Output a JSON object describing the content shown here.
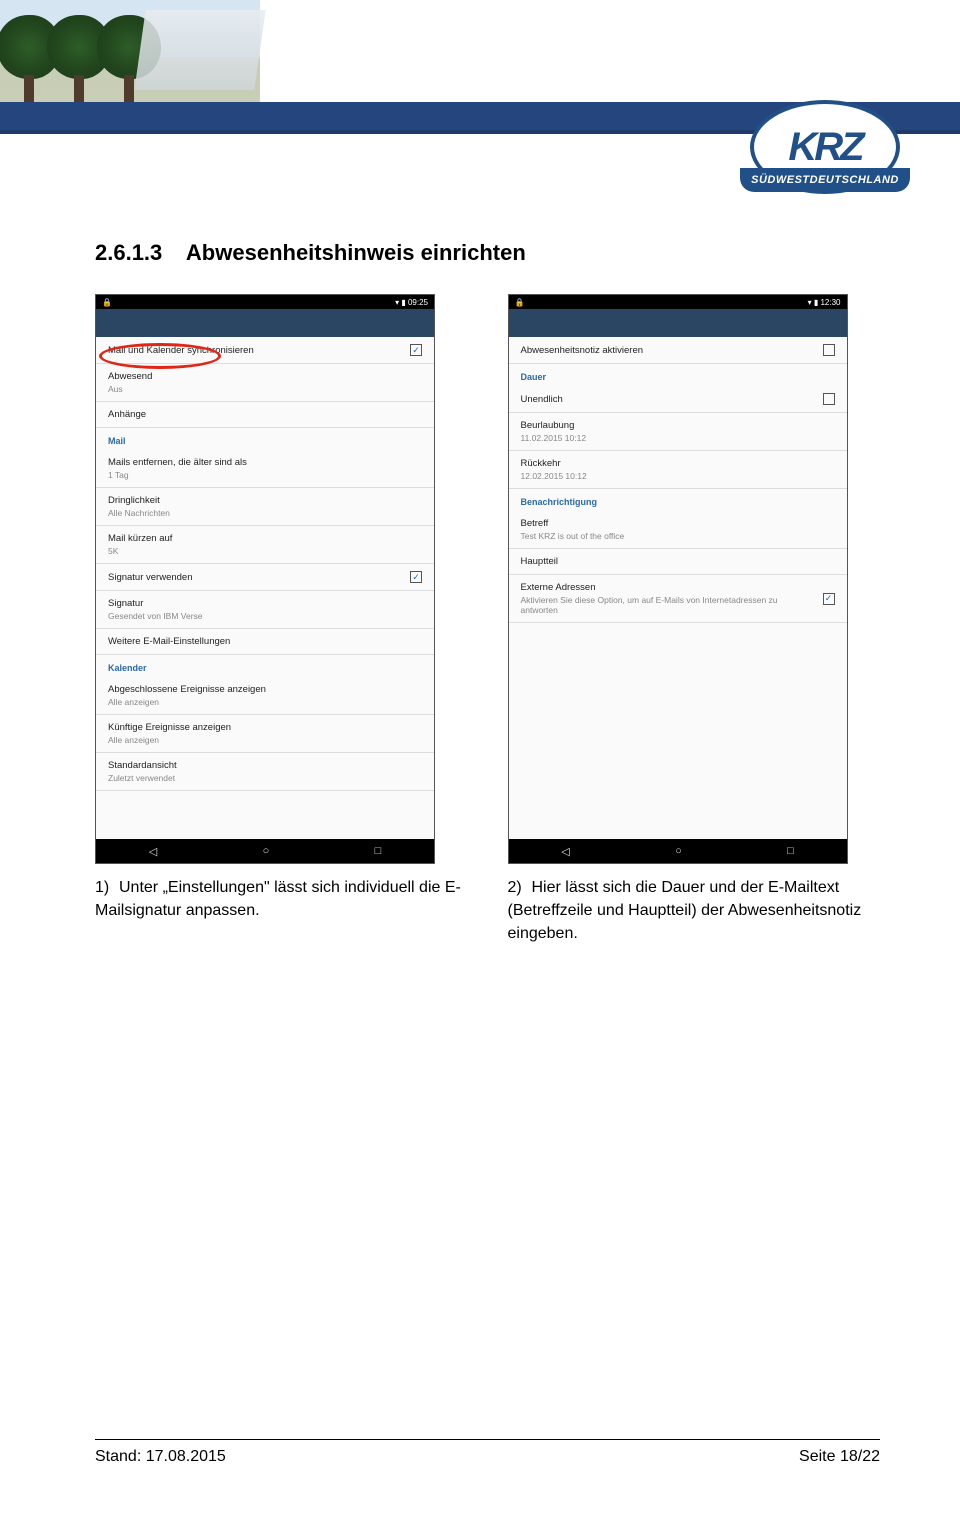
{
  "logo": {
    "text": "KRZ",
    "ribbon": "SÜDWESTDEUTSCHLAND"
  },
  "section": {
    "number": "2.6.1.3",
    "title": "Abwesenheitshinweis einrichten"
  },
  "screenshot1": {
    "time": "09:25",
    "lock": "🔒",
    "rows": {
      "sync": "Mail und Kalender synchronisieren",
      "abwesend": "Abwesend",
      "abwesend_sub": "Aus",
      "anhange": "Anhänge",
      "mail_hdr": "Mail",
      "entfernen": "Mails entfernen, die älter sind als",
      "entfernen_sub": "1 Tag",
      "dring": "Dringlichkeit",
      "dring_sub": "Alle Nachrichten",
      "kurzen": "Mail kürzen auf",
      "kurzen_sub": "5K",
      "sigver": "Signatur verwenden",
      "signatur": "Signatur",
      "signatur_sub": "Gesendet von IBM Verse",
      "weitere": "Weitere E-Mail-Einstellungen",
      "kal_hdr": "Kalender",
      "abg": "Abgeschlossene Ereignisse anzeigen",
      "abg_sub": "Alle anzeigen",
      "kunf": "Künftige Ereignisse anzeigen",
      "kunf_sub": "Alle anzeigen",
      "std": "Standardansicht",
      "std_sub": "Zuletzt verwendet"
    }
  },
  "screenshot2": {
    "time": "12:30",
    "lock": "🔒",
    "rows": {
      "aktivieren": "Abwesenheitsnotiz aktivieren",
      "dauer_hdr": "Dauer",
      "unendlich": "Unendlich",
      "beurl": "Beurlaubung",
      "beurl_sub": "11.02.2015 10:12",
      "ruck": "Rückkehr",
      "ruck_sub": "12.02.2015 10:12",
      "benach_hdr": "Benachrichtigung",
      "betreff": "Betreff",
      "betreff_sub": "Test KRZ is out of the office",
      "haupt": "Hauptteil",
      "ext": "Externe Adressen",
      "ext_sub": "Aktivieren Sie diese Option, um auf E-Mails von Internetadressen zu antworten"
    }
  },
  "captions": {
    "c1_num": "1)",
    "c1": "Unter „Einstellungen\" lässt sich individuell die E-Mailsignatur anpassen.",
    "c2_num": "2)",
    "c2": "Hier lässt sich die Dauer und der E-Mailtext (Betreffzeile und Hauptteil) der Abwesenheitsnotiz eingeben."
  },
  "footer": {
    "stand": "Stand: 17.08.2015",
    "seite": "Seite 18/22"
  }
}
